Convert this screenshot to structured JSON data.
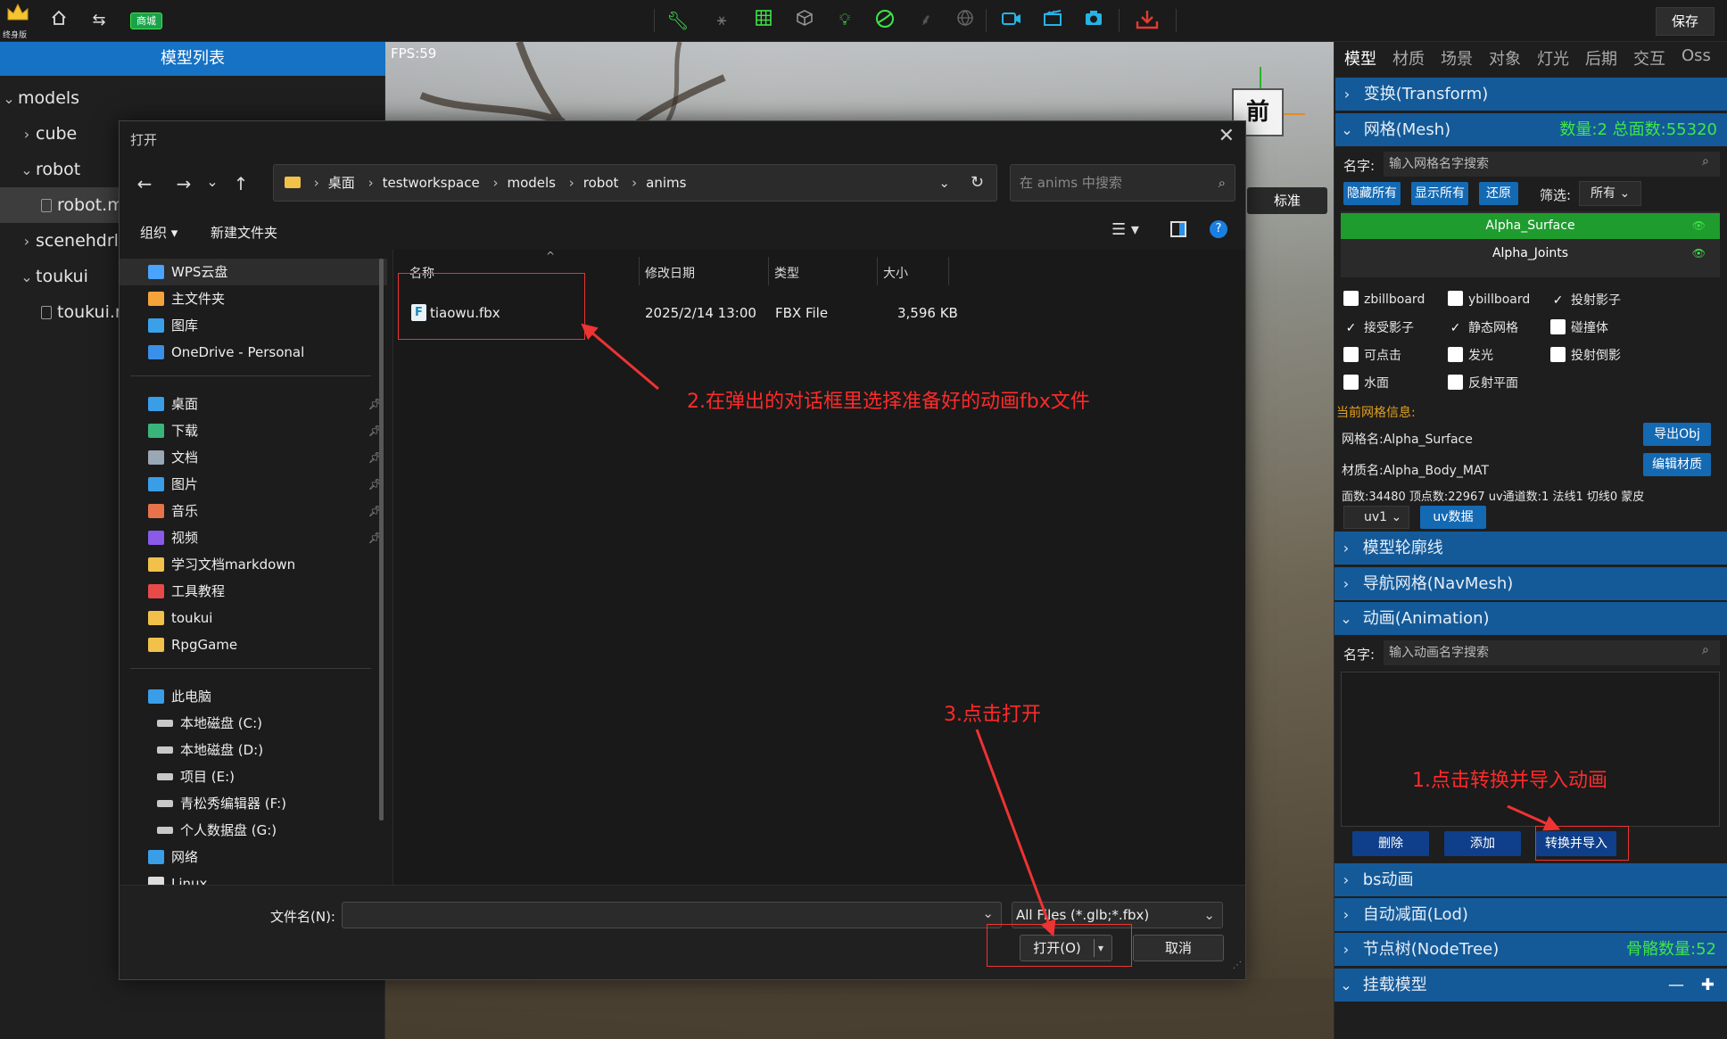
{
  "topbar": {
    "edition_label": "终身版",
    "store_badge": "商城",
    "save_label": "保存",
    "icons": [
      "crown-icon",
      "home-icon",
      "swap-icon",
      "wrench-icon",
      "skeleton-icon",
      "grid-icon",
      "cube-icon",
      "bulb-icon",
      "ball-icon",
      "tree-icon",
      "globe-icon",
      "video-icon",
      "clapper-icon",
      "camera-icon",
      "download-icon"
    ],
    "accent_green": "#3ee648",
    "accent_cyan": "#26b4e6",
    "accent_red": "#e83a2e"
  },
  "left_panel": {
    "title": "模型列表",
    "items": [
      {
        "label": "models",
        "level": 0,
        "expanded": true
      },
      {
        "label": "cube",
        "level": 1,
        "expanded": false
      },
      {
        "label": "robot",
        "level": 1,
        "expanded": true
      },
      {
        "label": "robot.m",
        "level": 2,
        "selected": true
      },
      {
        "label": "scenehdrlig",
        "level": 1,
        "expanded": false
      },
      {
        "label": "toukui",
        "level": 1,
        "expanded": true
      },
      {
        "label": "toukui.n",
        "level": 2
      }
    ],
    "accent": "#1572c5"
  },
  "viewport": {
    "fps": "FPS:59",
    "view_cube_face": "前",
    "view_mode": "标准"
  },
  "right_panel": {
    "tabs": [
      "模型",
      "材质",
      "场景",
      "对象",
      "灯光",
      "后期",
      "交互",
      "Oss"
    ],
    "active_tab": "模型",
    "sections": {
      "transform": "变换(Transform)",
      "mesh": "网格(Mesh)",
      "mesh_stats": "数量:2 总面数:55320",
      "outline": "模型轮廓线",
      "navmesh": "导航网格(NavMesh)",
      "animation": "动画(Animation)",
      "bs": "bs动画",
      "lod": "自动减面(Lod)",
      "nodetree": "节点树(NodeTree)",
      "bone_count": "骨骼数量:52",
      "mount": "挂载模型"
    },
    "mesh": {
      "name_label": "名字:",
      "search_placeholder": "输入网格名字搜索",
      "hide_all": "隐藏所有",
      "show_all": "显示所有",
      "restore": "还原",
      "filter_label": "筛选:",
      "filter_value": "所有",
      "list": [
        "Alpha_Surface",
        "Alpha_Joints"
      ],
      "selected_index": 0,
      "checkboxes": [
        {
          "label": "zbillboard",
          "checked": false
        },
        {
          "label": "ybillboard",
          "checked": false
        },
        {
          "label": "投射影子",
          "checked": true
        },
        {
          "label": "接受影子",
          "checked": true
        },
        {
          "label": "静态网格",
          "checked": true
        },
        {
          "label": "碰撞体",
          "checked": false
        },
        {
          "label": "可点击",
          "checked": false
        },
        {
          "label": "发光",
          "checked": false
        },
        {
          "label": "投射倒影",
          "checked": false
        },
        {
          "label": "水面",
          "checked": false
        },
        {
          "label": "反射平面",
          "checked": false
        }
      ],
      "info_title": "当前网格信息:",
      "mesh_name": "网格名:Alpha_Surface",
      "export_obj": "导出Obj",
      "material_name": "材质名:Alpha_Body_MAT",
      "edit_material": "编辑材质",
      "stats_line": "面数:34480 顶点数:22967 uv通道数:1 法线1 切线0 蒙皮",
      "uv_select": "uv1",
      "uv_data": "uv数据",
      "info_color": "#e0a020"
    },
    "animation": {
      "name_label": "名字:",
      "search_placeholder": "输入动画名字搜索",
      "delete": "删除",
      "add": "添加",
      "convert_import": "转换并导入"
    },
    "mount_minus": "—",
    "mount_plus": "✚",
    "header_color": "#145a99"
  },
  "dialog": {
    "title": "打开",
    "path": [
      "桌面",
      "testworkspace",
      "models",
      "robot",
      "anims"
    ],
    "search_placeholder": "在 anims 中搜索",
    "organize": "组织",
    "new_folder": "新建文件夹",
    "nav_groups": [
      [
        {
          "label": "WPS云盘",
          "icon": "cloud-icon",
          "color": "#4aa3ff",
          "selected": true
        },
        {
          "label": "主文件夹",
          "icon": "home-icon",
          "color": "#f3a33a"
        },
        {
          "label": "图库",
          "icon": "gallery-icon",
          "color": "#3aa0e8"
        },
        {
          "label": "OneDrive - Personal",
          "icon": "onedrive-icon",
          "color": "#3a8fe8"
        }
      ],
      [
        {
          "label": "桌面",
          "icon": "desktop-icon",
          "color": "#3a9de8",
          "pinned": true
        },
        {
          "label": "下载",
          "icon": "download-icon",
          "color": "#3ab57a",
          "pinned": true
        },
        {
          "label": "文档",
          "icon": "document-icon",
          "color": "#9aa7b5",
          "pinned": true
        },
        {
          "label": "图片",
          "icon": "picture-icon",
          "color": "#3a9de8",
          "pinned": true
        },
        {
          "label": "音乐",
          "icon": "music-icon",
          "color": "#e8734a",
          "pinned": true
        },
        {
          "label": "视频",
          "icon": "video-icon",
          "color": "#8a5ae8",
          "pinned": true
        },
        {
          "label": "学习文档markdown",
          "icon": "folder-icon",
          "color": "#f2c14a"
        },
        {
          "label": "工具教程",
          "icon": "folder-icon",
          "color": "#e84a4a"
        },
        {
          "label": "toukui",
          "icon": "folder-icon",
          "color": "#f2c14a"
        },
        {
          "label": "RpgGame",
          "icon": "folder-icon",
          "color": "#f2c14a"
        }
      ],
      [
        {
          "label": "此电脑",
          "icon": "computer-icon",
          "color": "#3a9de8"
        },
        {
          "label": "本地磁盘 (C:)",
          "icon": "drive-icon",
          "color": "#c8c8c8",
          "indent": true
        },
        {
          "label": "本地磁盘 (D:)",
          "icon": "drive-icon",
          "color": "#c8c8c8",
          "indent": true
        },
        {
          "label": "项目 (E:)",
          "icon": "drive-icon",
          "color": "#c8c8c8",
          "indent": true
        },
        {
          "label": "青松秀编辑器 (F:)",
          "icon": "drive-icon",
          "color": "#c8c8c8",
          "indent": true
        },
        {
          "label": "个人数据盘 (G:)",
          "icon": "drive-icon",
          "color": "#c8c8c8",
          "indent": true
        },
        {
          "label": "网络",
          "icon": "network-icon",
          "color": "#3a9de8"
        },
        {
          "label": "Linux",
          "icon": "linux-icon",
          "color": "#dddddd"
        }
      ]
    ],
    "columns": [
      "名称",
      "修改日期",
      "类型",
      "大小"
    ],
    "files": [
      {
        "name": "tiaowu.fbx",
        "modified": "2025/2/14 13:00",
        "type": "FBX File",
        "size": "3,596 KB"
      }
    ],
    "filename_label": "文件名(N):",
    "filename_value": "",
    "filetype": "All Files (*.glb;*.fbx)",
    "open": "打开(O)",
    "cancel": "取消"
  },
  "annotations": {
    "step1": "1.点击转换并导入动画",
    "step2": "2.在弹出的对话框里选择准备好的动画fbx文件",
    "step3": "3.点击打开",
    "color": "#ff2a2a"
  }
}
